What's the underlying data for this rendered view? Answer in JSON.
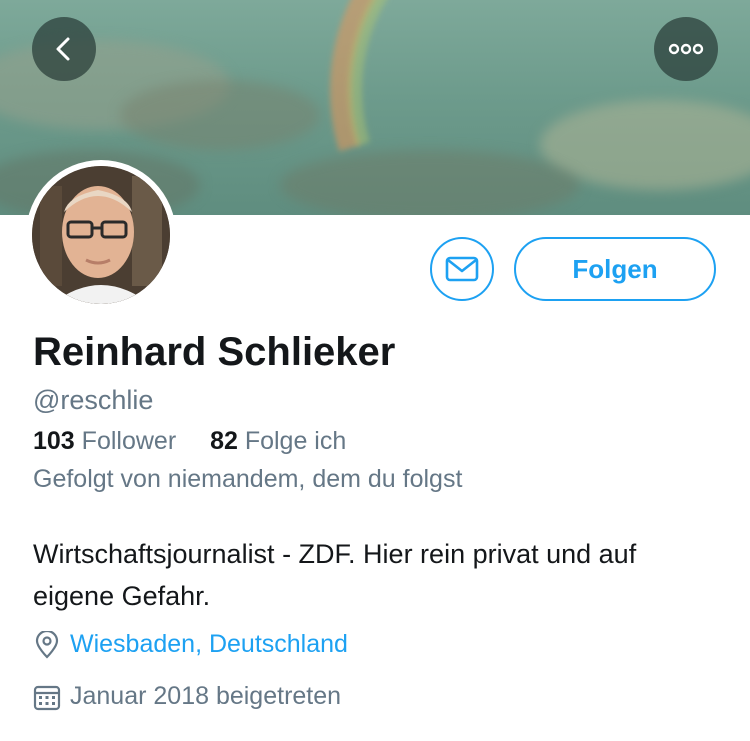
{
  "header": {
    "back_icon": "chevron-left-icon",
    "more_icon": "more-dots-icon"
  },
  "actions": {
    "message_icon": "envelope-icon",
    "follow_label": "Folgen"
  },
  "profile": {
    "name": "Reinhard Schlieker",
    "handle": "@reschlie",
    "followers_count": "103",
    "followers_label": "Follower",
    "following_count": "82",
    "following_label": "Folge ich",
    "followed_by": "Gefolgt von niemandem, dem du folgst",
    "bio": "Wirtschaftsjournalist - ZDF. Hier rein privat und auf eigene Gefahr.",
    "location": "Wiesbaden, Deutschland",
    "joined": "Januar 2018 beigetreten"
  },
  "colors": {
    "accent": "#1da1f2",
    "secondary_text": "#657786",
    "primary_text": "#14171a"
  }
}
